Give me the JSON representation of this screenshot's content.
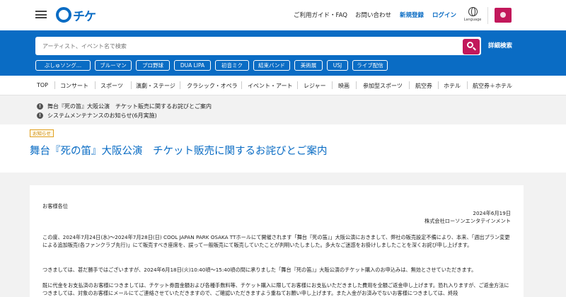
{
  "header": {
    "logo_text": "チケ",
    "links": {
      "guide": "ご利用ガイド・FAQ",
      "contact": "お問い合わせ",
      "register": "新規登録",
      "login": "ログイン"
    },
    "language_label": "Language"
  },
  "search": {
    "placeholder": "アーティスト、イベント名で検索",
    "value": "",
    "advanced_label": "詳細検索",
    "chips": [
      "ぶしゅソング…",
      "ブルーマン",
      "プロ野球",
      "DUA LIPA",
      "初音ミク",
      "結束バンド",
      "美術展",
      "USJ",
      "ライブ配信"
    ]
  },
  "categories": [
    "TOP",
    "コンサート",
    "スポーツ",
    "演劇・ステージ",
    "クラシック・オペラ",
    "イベント・アート",
    "レジャー",
    "映画",
    "参加型スポーツ",
    "航空券",
    "ホテル",
    "航空券＋ホテル"
  ],
  "notices": [
    "舞台『死の笛』大阪公演　チケット販売に関するお詫びとご案内",
    "システムメンテナンスのお知らせ(6月実施)"
  ],
  "page": {
    "tag": "お知らせ",
    "title": "舞台『死の笛』大阪公演　チケット販売に関するお詫びとご案内"
  },
  "article": {
    "greeting": "お客様各位",
    "date": "2024年6月19日",
    "company": "株式会社ローソンエンタテインメント",
    "p1": "この度、2024年7月24日(水)〜2024年7月28日(日) COOL JAPAN PARK OSAKA TTホールにて開催されます「舞台『死の笛』」大阪公演におきまして、弊社の販売設定不備により、本来、「週出プラン変更による追加販売(各ファンクラブ先行)」にて販売すべき座席を、誤って一般販売にて販売していたことが判明いたしました。多大なご迷惑をお掛けしましたことを深くお詫び申し上げます。",
    "p2": "つきましては、甚だ勝手ではございますが、2024年6月18日(火)10:40頃〜15:40頃の間に承りました「舞台『死の笛』」大阪公演のチケット購入のお申込みは、無効とさせていただきます。",
    "p3": "既に代金をお支払済のお客様につきましては、チケット券面金額および各種手数料等、チケット購入に際してお客様にお支払いただきました費用を全額ご返金申し上げます。恐れ入りますが、ご返金方法につきましては、対象のお客様にメールにてご連絡させていただきますので、ご確認いただきますよう重ねてお願い申し上げます。また入金がお済みでないお客様につきましては、終段"
  },
  "colors": {
    "brand_blue": "#0a6cc4",
    "accent_magenta": "#c2185b"
  }
}
